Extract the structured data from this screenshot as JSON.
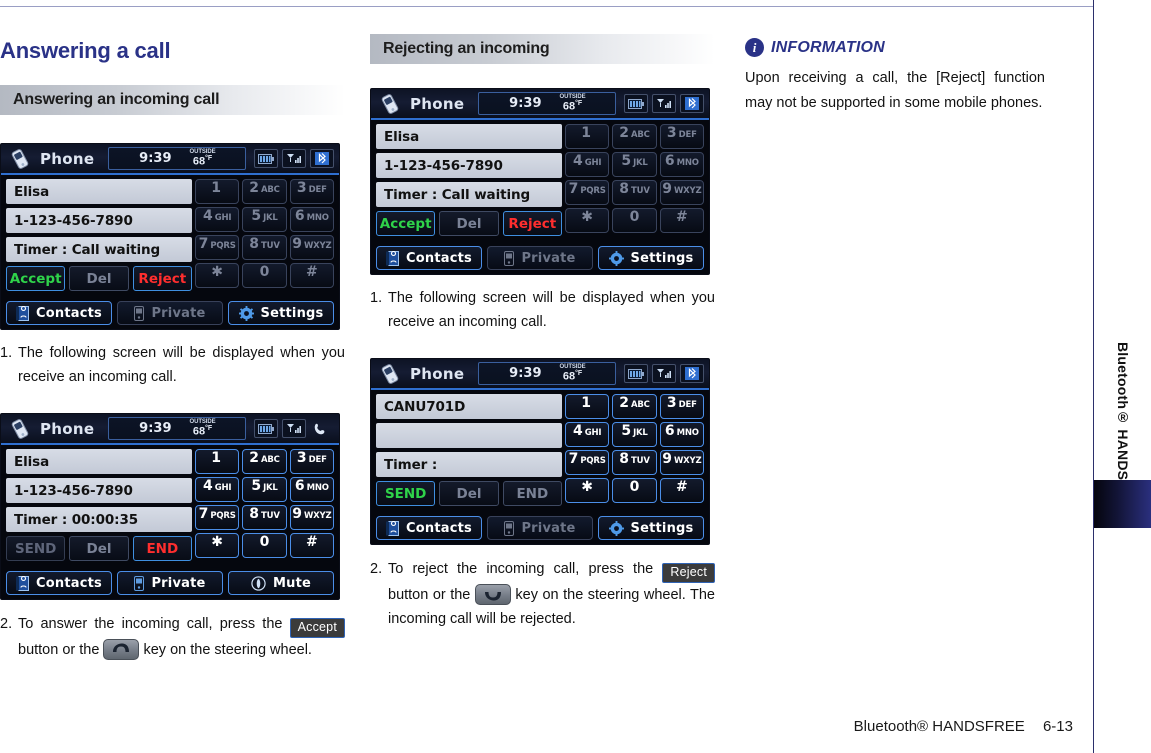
{
  "page_title": "Answering a call",
  "footer": {
    "text": "Bluetooth® HANDSFREE",
    "page_number": "6-13"
  },
  "sidebar": {
    "vertical_label": "Bluetooth® HANDSFREE"
  },
  "colors": {
    "heading_blue": "#2a3287",
    "accept_green": "#2fd34a",
    "reject_red": "#ff2e2e",
    "key_border_blue": "#4b8ee8",
    "section_header_gray": "#b4b9c2"
  },
  "columns": {
    "left": {
      "section_header": "Answering an incoming call",
      "steps": [
        {
          "num": "1.",
          "text": "The following screen will be displayed when you receive an incoming call."
        },
        {
          "num": "2.",
          "parts": [
            {
              "type": "text",
              "value": "To answer the incoming call, press the "
            },
            {
              "type": "badge",
              "value": "Accept"
            },
            {
              "type": "text",
              "value": " button or the "
            },
            {
              "type": "key",
              "value": "call-answer-key"
            },
            {
              "type": "text",
              "value": " key on the steering wheel."
            }
          ]
        }
      ],
      "screens": [
        {
          "id": "incoming-call-waiting",
          "header": {
            "app": "Phone",
            "time": "9:39",
            "outside_label": "OUTSIDE",
            "temp": "68",
            "temp_unit": "°F",
            "status_icons": [
              "battery-icon",
              "signal-icon",
              "bluetooth-icon"
            ]
          },
          "fields": [
            "Elisa",
            "1-123-456-7890",
            "Timer : Call waiting"
          ],
          "actions": [
            {
              "label": "Accept",
              "state": "green"
            },
            {
              "label": "Del",
              "state": "dim"
            },
            {
              "label": "Reject",
              "state": "red"
            }
          ],
          "keypad_state": "muted",
          "keypad": [
            {
              "d": "1",
              "l": ""
            },
            {
              "d": "2",
              "l": "ABC"
            },
            {
              "d": "3",
              "l": "DEF"
            },
            {
              "d": "4",
              "l": "GHI"
            },
            {
              "d": "5",
              "l": "JKL"
            },
            {
              "d": "6",
              "l": "MNO"
            },
            {
              "d": "7",
              "l": "PQRS"
            },
            {
              "d": "8",
              "l": "TUV"
            },
            {
              "d": "9",
              "l": "WXYZ"
            },
            {
              "d": "✱",
              "l": ""
            },
            {
              "d": "0",
              "l": ""
            },
            {
              "d": "#",
              "l": ""
            }
          ],
          "bottom": [
            {
              "label": "Contacts",
              "icon": "contacts-book-icon",
              "state": "on"
            },
            {
              "label": "Private",
              "icon": "private-phone-icon",
              "state": "off"
            },
            {
              "label": "Settings",
              "icon": "gear-icon",
              "state": "on"
            }
          ]
        },
        {
          "id": "active-call",
          "header": {
            "app": "Phone",
            "time": "9:39",
            "outside_label": "OUTSIDE",
            "temp": "68",
            "temp_unit": "°F",
            "status_icons": [
              "battery-icon",
              "signal-icon",
              "handset-icon"
            ]
          },
          "fields": [
            "Elisa",
            "1-123-456-7890",
            "Timer : 00:00:35"
          ],
          "actions": [
            {
              "label": "SEND",
              "state": "dim"
            },
            {
              "label": "Del",
              "state": "dim"
            },
            {
              "label": "END",
              "state": "red"
            }
          ],
          "keypad_state": "active",
          "keypad": [
            {
              "d": "1",
              "l": ""
            },
            {
              "d": "2",
              "l": "ABC"
            },
            {
              "d": "3",
              "l": "DEF"
            },
            {
              "d": "4",
              "l": "GHI"
            },
            {
              "d": "5",
              "l": "JKL"
            },
            {
              "d": "6",
              "l": "MNO"
            },
            {
              "d": "7",
              "l": "PQRS"
            },
            {
              "d": "8",
              "l": "TUV"
            },
            {
              "d": "9",
              "l": "WXYZ"
            },
            {
              "d": "✱",
              "l": ""
            },
            {
              "d": "0",
              "l": ""
            },
            {
              "d": "#",
              "l": ""
            }
          ],
          "bottom": [
            {
              "label": "Contacts",
              "icon": "contacts-book-icon",
              "state": "on"
            },
            {
              "label": "Private",
              "icon": "private-phone-icon",
              "state": "on"
            },
            {
              "label": "Mute",
              "icon": "mute-icon",
              "state": "on"
            }
          ]
        }
      ]
    },
    "middle": {
      "section_header": "Rejecting an incoming",
      "steps": [
        {
          "num": "1.",
          "text": "The following screen will be displayed when you receive an incoming call."
        },
        {
          "num": "2.",
          "parts": [
            {
              "type": "text",
              "value": "To reject the incoming call, press the "
            },
            {
              "type": "badge",
              "value": "Reject"
            },
            {
              "type": "text",
              "value": " button or the "
            },
            {
              "type": "key",
              "value": "call-end-key"
            },
            {
              "type": "text",
              "value": " key on the steering wheel.  The incoming call will be rejected."
            }
          ]
        }
      ],
      "screens": [
        {
          "id": "incoming-call-waiting-2",
          "header": {
            "app": "Phone",
            "time": "9:39",
            "outside_label": "OUTSIDE",
            "temp": "68",
            "temp_unit": "°F",
            "status_icons": [
              "battery-icon",
              "signal-icon",
              "bluetooth-icon"
            ]
          },
          "fields": [
            "Elisa",
            "1-123-456-7890",
            "Timer : Call waiting"
          ],
          "actions": [
            {
              "label": "Accept",
              "state": "green"
            },
            {
              "label": "Del",
              "state": "dim"
            },
            {
              "label": "Reject",
              "state": "red"
            }
          ],
          "keypad_state": "muted",
          "keypad": [
            {
              "d": "1",
              "l": ""
            },
            {
              "d": "2",
              "l": "ABC"
            },
            {
              "d": "3",
              "l": "DEF"
            },
            {
              "d": "4",
              "l": "GHI"
            },
            {
              "d": "5",
              "l": "JKL"
            },
            {
              "d": "6",
              "l": "MNO"
            },
            {
              "d": "7",
              "l": "PQRS"
            },
            {
              "d": "8",
              "l": "TUV"
            },
            {
              "d": "9",
              "l": "WXYZ"
            },
            {
              "d": "✱",
              "l": ""
            },
            {
              "d": "0",
              "l": ""
            },
            {
              "d": "#",
              "l": ""
            }
          ],
          "bottom": [
            {
              "label": "Contacts",
              "icon": "contacts-book-icon",
              "state": "on"
            },
            {
              "label": "Private",
              "icon": "private-phone-icon",
              "state": "off"
            },
            {
              "label": "Settings",
              "icon": "gear-icon",
              "state": "on"
            }
          ]
        },
        {
          "id": "rejected-call",
          "header": {
            "app": "Phone",
            "time": "9:39",
            "outside_label": "OUTSIDE",
            "temp": "68",
            "temp_unit": "°F",
            "status_icons": [
              "battery-icon",
              "signal-icon",
              "bluetooth-icon"
            ]
          },
          "fields": [
            "CANU701D",
            "",
            "Timer :"
          ],
          "actions": [
            {
              "label": "SEND",
              "state": "green"
            },
            {
              "label": "Del",
              "state": "dim"
            },
            {
              "label": "END",
              "state": "dim"
            }
          ],
          "keypad_state": "active",
          "keypad": [
            {
              "d": "1",
              "l": ""
            },
            {
              "d": "2",
              "l": "ABC"
            },
            {
              "d": "3",
              "l": "DEF"
            },
            {
              "d": "4",
              "l": "GHI"
            },
            {
              "d": "5",
              "l": "JKL"
            },
            {
              "d": "6",
              "l": "MNO"
            },
            {
              "d": "7",
              "l": "PQRS"
            },
            {
              "d": "8",
              "l": "TUV"
            },
            {
              "d": "9",
              "l": "WXYZ"
            },
            {
              "d": "✱",
              "l": ""
            },
            {
              "d": "0",
              "l": ""
            },
            {
              "d": "#",
              "l": ""
            }
          ],
          "bottom": [
            {
              "label": "Contacts",
              "icon": "contacts-book-icon",
              "state": "on"
            },
            {
              "label": "Private",
              "icon": "private-phone-icon",
              "state": "off"
            },
            {
              "label": "Settings",
              "icon": "gear-icon",
              "state": "on"
            }
          ]
        }
      ]
    },
    "right": {
      "info": {
        "icon": "info-icon",
        "icon_glyph": "i",
        "title": "INFORMATION",
        "body": "Upon receiving a call, the [Reject] function may not be supported in some mobile phones."
      }
    }
  }
}
